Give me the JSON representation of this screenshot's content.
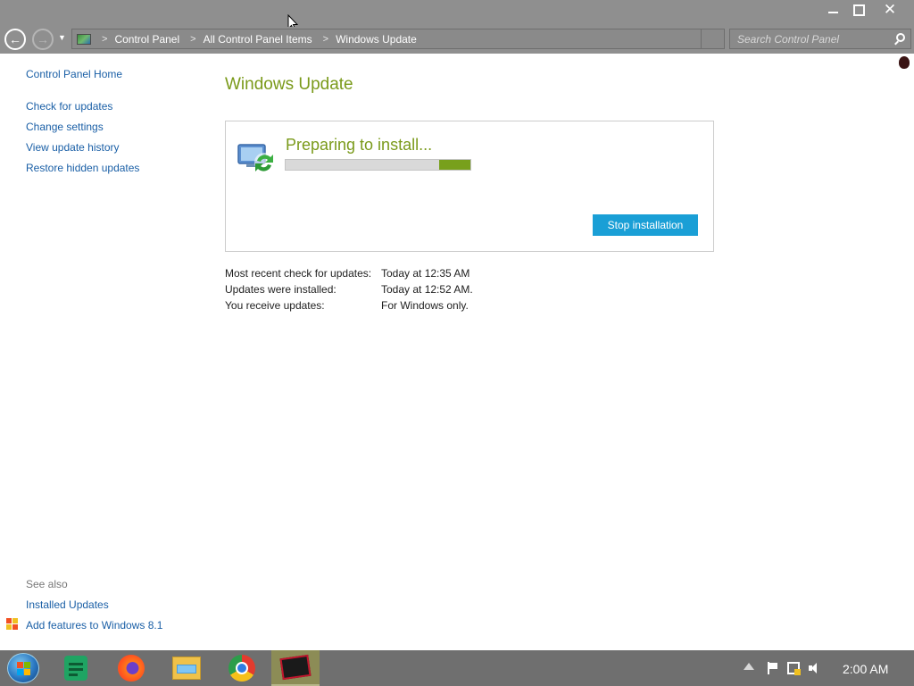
{
  "window": {
    "minimize_icon": "minimize-icon",
    "maximize_icon": "restore-icon",
    "close_icon": "close-icon",
    "close_glyph": "✕"
  },
  "navigation": {
    "back_glyph": "←",
    "forward_glyph": "→",
    "dropdown_glyph": "▼",
    "breadcrumb_sep": ">",
    "breadcrumb": [
      "Control Panel",
      "All Control Panel Items",
      "Windows Update"
    ],
    "search_placeholder": "Search Control Panel"
  },
  "sidebar": {
    "home": "Control Panel Home",
    "links": [
      "Check for updates",
      "Change settings",
      "View update history",
      "Restore hidden updates"
    ],
    "see_also_title": "See also",
    "see_also_links": [
      "Installed Updates",
      "Add features to Windows 8.1"
    ]
  },
  "main": {
    "title": "Windows Update",
    "status": "Preparing to install...",
    "progress_fraction": 0.17,
    "stop_button": "Stop installation",
    "info": [
      {
        "label": "Most recent check for updates:",
        "value": "Today at 12:35 AM"
      },
      {
        "label": "Updates were installed:",
        "value": "Today at 12:52 AM."
      },
      {
        "label": "You receive updates:",
        "value": "For Windows only."
      }
    ]
  },
  "colors": {
    "accent_green": "#7a9a1a",
    "progress_green": "#78a01c",
    "button_blue": "#1a9fd6",
    "link_blue": "#1a5fa6",
    "chrome_gray": "#8f8f8f",
    "taskbar_gray": "#6f6f6f"
  },
  "taskbar": {
    "apps": [
      "start-orb",
      "google-sheets",
      "firefox",
      "file-explorer",
      "chrome",
      "game"
    ],
    "clock": "2:00 AM"
  }
}
